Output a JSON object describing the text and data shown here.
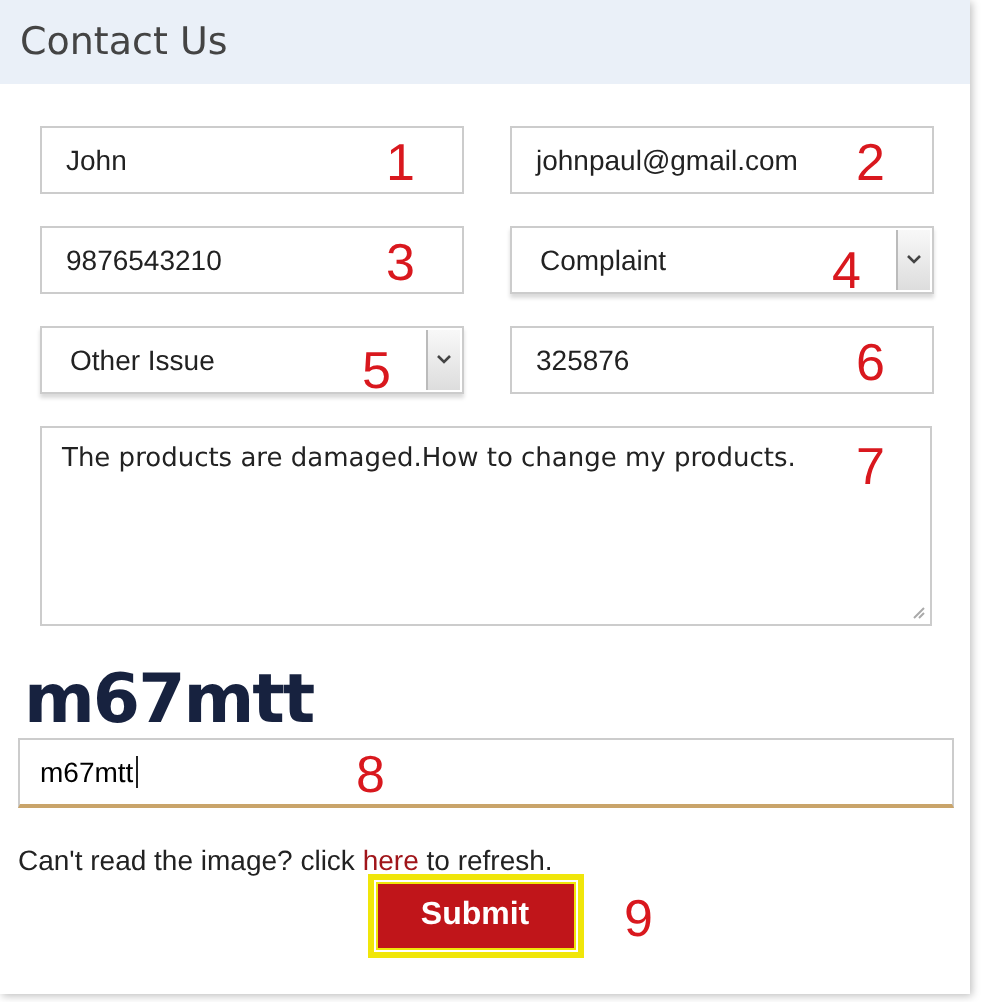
{
  "header": {
    "title": "Contact Us"
  },
  "fields": [
    {
      "kind": "input",
      "value": "John",
      "marker": "1"
    },
    {
      "kind": "input",
      "value": "johnpaul@gmail.com",
      "marker": "2"
    },
    {
      "kind": "input",
      "value": "9876543210",
      "marker": "3"
    },
    {
      "kind": "select",
      "value": "Complaint",
      "marker": "4"
    },
    {
      "kind": "select",
      "value": "Other Issue",
      "marker": "5"
    },
    {
      "kind": "input",
      "value": "325876",
      "marker": "6"
    }
  ],
  "message": {
    "value": "The products are damaged.How to change my products.",
    "marker": "7"
  },
  "captcha": {
    "text": "m67mtt",
    "input_value": "m67mtt",
    "marker": "8"
  },
  "refresh": {
    "before": "Can't read the image? click",
    "link": "here",
    "after": "to refresh."
  },
  "submit": {
    "label": "Submit",
    "marker": "9",
    "highlighted": true
  }
}
